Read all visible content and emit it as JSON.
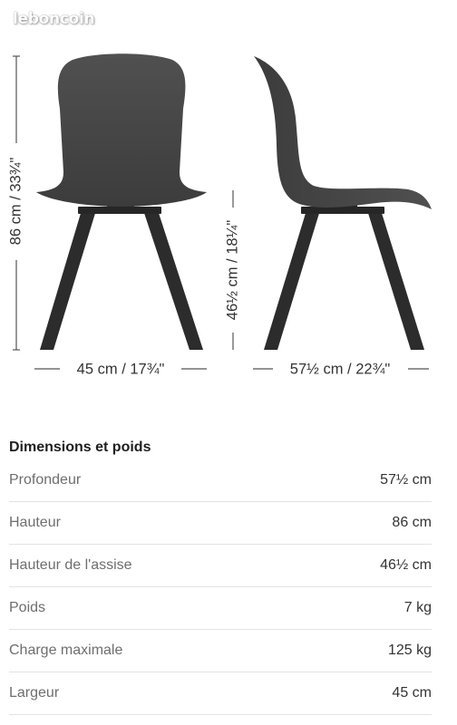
{
  "watermark": {
    "text": "leboncoin"
  },
  "diagram": {
    "front_height_label": "86 cm / 33¾\"",
    "seat_height_label": "46½ cm / 18¼\"",
    "front_width_label": "45 cm / 17¾\"",
    "side_depth_label": "57½ cm / 22¾\"",
    "colors": {
      "chair": "#3c3c3c",
      "chair_light": "#505050",
      "leg": "#2c2c2c"
    }
  },
  "specs": {
    "title": "Dimensions et poids",
    "rows": [
      {
        "label": "Profondeur",
        "value": "57½ cm"
      },
      {
        "label": "Hauteur",
        "value": "86 cm"
      },
      {
        "label": "Hauteur de l'assise",
        "value": "46½ cm"
      },
      {
        "label": "Poids",
        "value": "7 kg"
      },
      {
        "label": "Charge maximale",
        "value": "125 kg"
      },
      {
        "label": "Largeur",
        "value": "45 cm"
      }
    ]
  }
}
